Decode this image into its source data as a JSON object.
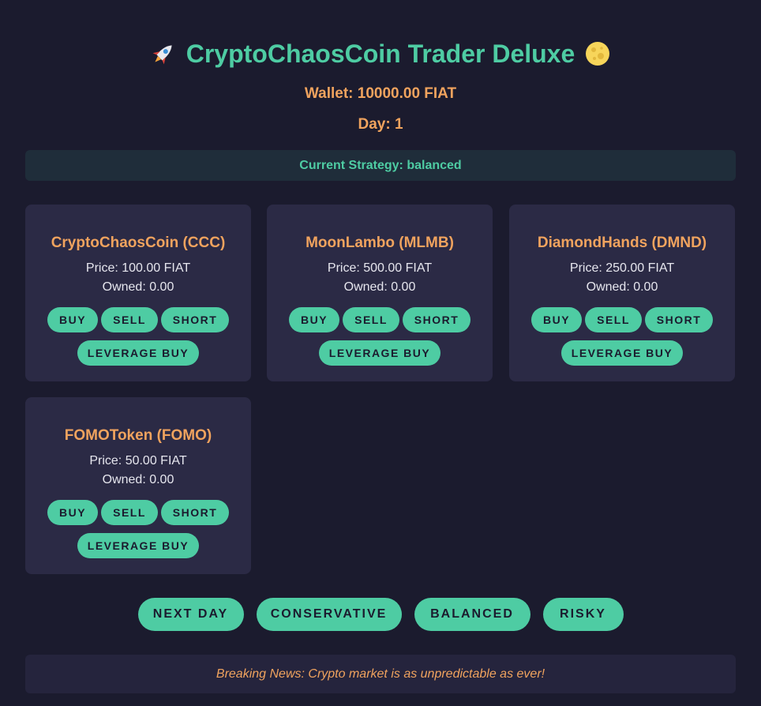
{
  "header": {
    "title": "CryptoChaosCoin Trader Deluxe",
    "left_icon": "rocket-icon",
    "right_icon": "moon-icon",
    "wallet": "Wallet: 10000.00 FIAT",
    "day": "Day: 1",
    "strategy": "Current Strategy: balanced"
  },
  "coins": [
    {
      "name": "CryptoChaosCoin (CCC)",
      "price": "Price: 100.00 FIAT",
      "owned": "Owned: 0.00",
      "buy": "Buy",
      "sell": "Sell",
      "short": "Short",
      "leverage": "Leverage Buy"
    },
    {
      "name": "MoonLambo (MLMB)",
      "price": "Price: 500.00 FIAT",
      "owned": "Owned: 0.00",
      "buy": "Buy",
      "sell": "Sell",
      "short": "Short",
      "leverage": "Leverage Buy"
    },
    {
      "name": "DiamondHands (DMND)",
      "price": "Price: 250.00 FIAT",
      "owned": "Owned: 0.00",
      "buy": "Buy",
      "sell": "Sell",
      "short": "Short",
      "leverage": "Leverage Buy"
    },
    {
      "name": "FOMOToken (FOMO)",
      "price": "Price: 50.00 FIAT",
      "owned": "Owned: 0.00",
      "buy": "Buy",
      "sell": "Sell",
      "short": "Short",
      "leverage": "Leverage Buy"
    }
  ],
  "controls": {
    "next_day": "Next Day",
    "conservative": "Conservative",
    "balanced": "Balanced",
    "risky": "Risky"
  },
  "news": "Breaking News: Crypto market is as unpredictable as ever!",
  "colors": {
    "background": "#1b1b2e",
    "accent": "#4ecca3",
    "highlight": "#f0a35e",
    "card": "#2b2a45"
  }
}
